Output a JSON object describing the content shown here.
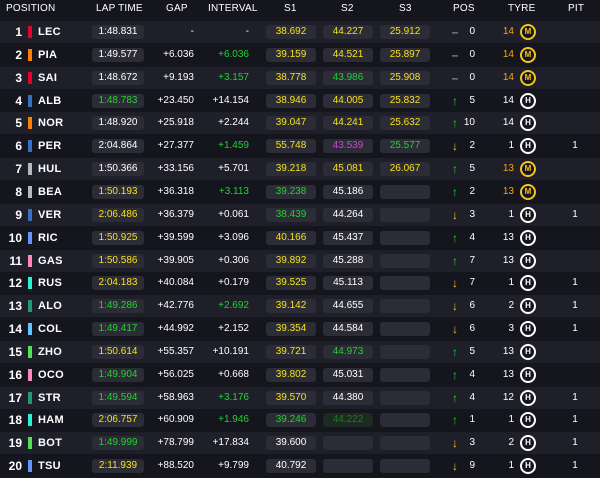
{
  "colors": {
    "yellow": "#f5e01c",
    "green": "#22d130",
    "purple": "#c94ad6",
    "white": "#ffffff",
    "orange": "#f5a511",
    "arrow_up": "#22d130",
    "arrow_down": "#f5c518"
  },
  "headers": {
    "position": "POSITION",
    "lap_time": "LAP TIME",
    "gap": "GAP",
    "interval": "INTERVAL",
    "s1": "S1",
    "s2": "S2",
    "s3": "S3",
    "pos": "POS",
    "tyre": "TYRE",
    "pit": "PIT"
  },
  "rows": [
    {
      "pos": "1",
      "code": "LEC",
      "team": "#e8002d",
      "lap": "1:48.831",
      "lap_c": "white",
      "gap": "-",
      "gap_c": "white",
      "int": "-",
      "int_c": "white",
      "s1": "38.692",
      "s1_c": "yellow",
      "s2": "44.227",
      "s2_c": "yellow",
      "s3": "25.912",
      "s3_c": "yellow",
      "dir": "none",
      "chg": "0",
      "laps": "14",
      "laps_c": "orange",
      "tyre": "M",
      "tyre_c": "#f5c518",
      "pit": ""
    },
    {
      "pos": "2",
      "code": "PIA",
      "team": "#ff8000",
      "lap": "1:49.577",
      "lap_c": "white",
      "gap": "+6.036",
      "gap_c": "white",
      "int": "+6.036",
      "int_c": "green",
      "s1": "39.159",
      "s1_c": "yellow",
      "s2": "44.521",
      "s2_c": "yellow",
      "s3": "25.897",
      "s3_c": "yellow",
      "dir": "none",
      "chg": "0",
      "laps": "14",
      "laps_c": "orange",
      "tyre": "M",
      "tyre_c": "#f5c518",
      "pit": ""
    },
    {
      "pos": "3",
      "code": "SAI",
      "team": "#e8002d",
      "lap": "1:48.672",
      "lap_c": "white",
      "gap": "+9.193",
      "gap_c": "white",
      "int": "+3.157",
      "int_c": "green",
      "s1": "38.778",
      "s1_c": "yellow",
      "s2": "43.986",
      "s2_c": "green",
      "s3": "25.908",
      "s3_c": "yellow",
      "dir": "none",
      "chg": "0",
      "laps": "14",
      "laps_c": "orange",
      "tyre": "M",
      "tyre_c": "#f5c518",
      "pit": ""
    },
    {
      "pos": "4",
      "code": "ALB",
      "team": "#3671c6",
      "lap": "1:48.783",
      "lap_c": "green",
      "gap": "+23.450",
      "gap_c": "white",
      "int": "+14.154",
      "int_c": "white",
      "s1": "38.946",
      "s1_c": "yellow",
      "s2": "44.005",
      "s2_c": "yellow",
      "s3": "25.832",
      "s3_c": "yellow",
      "dir": "up",
      "chg": "5",
      "laps": "14",
      "laps_c": "white",
      "tyre": "H",
      "tyre_c": "#ffffff",
      "pit": ""
    },
    {
      "pos": "5",
      "code": "NOR",
      "team": "#ff8000",
      "lap": "1:48.920",
      "lap_c": "white",
      "gap": "+25.918",
      "gap_c": "white",
      "int": "+2.244",
      "int_c": "white",
      "s1": "39.047",
      "s1_c": "yellow",
      "s2": "44.241",
      "s2_c": "yellow",
      "s3": "25.632",
      "s3_c": "yellow",
      "dir": "up",
      "chg": "10",
      "laps": "14",
      "laps_c": "white",
      "tyre": "H",
      "tyre_c": "#ffffff",
      "pit": ""
    },
    {
      "pos": "6",
      "code": "PER",
      "team": "#3671c6",
      "lap": "2:04.864",
      "lap_c": "white",
      "gap": "+27.377",
      "gap_c": "white",
      "int": "+1.459",
      "int_c": "green",
      "s1": "55.748",
      "s1_c": "yellow",
      "s2": "43.539",
      "s2_c": "purple",
      "s3": "25.577",
      "s3_c": "green",
      "dir": "down",
      "chg": "2",
      "laps": "1",
      "laps_c": "white",
      "tyre": "H",
      "tyre_c": "#ffffff",
      "pit": "1"
    },
    {
      "pos": "7",
      "code": "HUL",
      "team": "#b6babd",
      "lap": "1:50.366",
      "lap_c": "white",
      "gap": "+33.156",
      "gap_c": "white",
      "int": "+5.701",
      "int_c": "white",
      "s1": "39.218",
      "s1_c": "yellow",
      "s2": "45.081",
      "s2_c": "yellow",
      "s3": "26.067",
      "s3_c": "yellow",
      "dir": "up",
      "chg": "5",
      "laps": "13",
      "laps_c": "orange",
      "tyre": "M",
      "tyre_c": "#f5c518",
      "pit": ""
    },
    {
      "pos": "8",
      "code": "BEA",
      "team": "#b6babd",
      "lap": "1:50.193",
      "lap_c": "yellow",
      "gap": "+36.318",
      "gap_c": "white",
      "int": "+3.113",
      "int_c": "green",
      "s1": "39.238",
      "s1_c": "green",
      "s2": "45.186",
      "s2_c": "white",
      "s3": "",
      "s3_c": "white",
      "dir": "up",
      "chg": "2",
      "laps": "13",
      "laps_c": "orange",
      "tyre": "M",
      "tyre_c": "#f5c518",
      "pit": ""
    },
    {
      "pos": "9",
      "code": "VER",
      "team": "#3671c6",
      "lap": "2:06.486",
      "lap_c": "yellow",
      "gap": "+36.379",
      "gap_c": "white",
      "int": "+0.061",
      "int_c": "white",
      "s1": "38.439",
      "s1_c": "green",
      "s2": "44.264",
      "s2_c": "white",
      "s3": "",
      "s3_c": "white",
      "dir": "down",
      "chg": "3",
      "laps": "1",
      "laps_c": "white",
      "tyre": "H",
      "tyre_c": "#ffffff",
      "pit": "1"
    },
    {
      "pos": "10",
      "code": "RIC",
      "team": "#6692ff",
      "lap": "1:50.925",
      "lap_c": "yellow",
      "gap": "+39.599",
      "gap_c": "white",
      "int": "+3.096",
      "int_c": "white",
      "s1": "40.166",
      "s1_c": "yellow",
      "s2": "45.437",
      "s2_c": "white",
      "s3": "",
      "s3_c": "white",
      "dir": "up",
      "chg": "4",
      "laps": "13",
      "laps_c": "white",
      "tyre": "H",
      "tyre_c": "#ffffff",
      "pit": ""
    },
    {
      "pos": "11",
      "code": "GAS",
      "team": "#ff87bc",
      "lap": "1:50.586",
      "lap_c": "yellow",
      "gap": "+39.905",
      "gap_c": "white",
      "int": "+0.306",
      "int_c": "white",
      "s1": "39.892",
      "s1_c": "yellow",
      "s2": "45.288",
      "s2_c": "white",
      "s3": "",
      "s3_c": "white",
      "dir": "up",
      "chg": "7",
      "laps": "13",
      "laps_c": "white",
      "tyre": "H",
      "tyre_c": "#ffffff",
      "pit": ""
    },
    {
      "pos": "12",
      "code": "RUS",
      "team": "#27f4d2",
      "lap": "2:04.183",
      "lap_c": "yellow",
      "gap": "+40.084",
      "gap_c": "white",
      "int": "+0.179",
      "int_c": "white",
      "s1": "39.525",
      "s1_c": "yellow",
      "s2": "45.113",
      "s2_c": "white",
      "s3": "",
      "s3_c": "white",
      "dir": "down",
      "chg": "7",
      "laps": "1",
      "laps_c": "white",
      "tyre": "H",
      "tyre_c": "#ffffff",
      "pit": "1"
    },
    {
      "pos": "13",
      "code": "ALO",
      "team": "#229971",
      "lap": "1:49.286",
      "lap_c": "green",
      "gap": "+42.776",
      "gap_c": "white",
      "int": "+2.692",
      "int_c": "green",
      "s1": "39.142",
      "s1_c": "yellow",
      "s2": "44.655",
      "s2_c": "white",
      "s3": "",
      "s3_c": "white",
      "dir": "down",
      "chg": "6",
      "laps": "2",
      "laps_c": "white",
      "tyre": "H",
      "tyre_c": "#ffffff",
      "pit": "1"
    },
    {
      "pos": "14",
      "code": "COL",
      "team": "#64c4ff",
      "lap": "1:49.417",
      "lap_c": "green",
      "gap": "+44.992",
      "gap_c": "white",
      "int": "+2.152",
      "int_c": "white",
      "s1": "39.354",
      "s1_c": "yellow",
      "s2": "44.584",
      "s2_c": "white",
      "s3": "",
      "s3_c": "white",
      "dir": "down",
      "chg": "6",
      "laps": "3",
      "laps_c": "white",
      "tyre": "H",
      "tyre_c": "#ffffff",
      "pit": "1"
    },
    {
      "pos": "15",
      "code": "ZHO",
      "team": "#52e252",
      "lap": "1:50.614",
      "lap_c": "yellow",
      "gap": "+55.357",
      "gap_c": "white",
      "int": "+10.191",
      "int_c": "white",
      "s1": "39.721",
      "s1_c": "yellow",
      "s2": "44.973",
      "s2_c": "green",
      "s3": "",
      "s3_c": "white",
      "dir": "up",
      "chg": "5",
      "laps": "13",
      "laps_c": "white",
      "tyre": "H",
      "tyre_c": "#ffffff",
      "pit": ""
    },
    {
      "pos": "16",
      "code": "OCO",
      "team": "#ff87bc",
      "lap": "1:49.904",
      "lap_c": "green",
      "gap": "+56.025",
      "gap_c": "white",
      "int": "+0.668",
      "int_c": "white",
      "s1": "39.802",
      "s1_c": "yellow",
      "s2": "45.031",
      "s2_c": "white",
      "s3": "",
      "s3_c": "white",
      "dir": "up",
      "chg": "4",
      "laps": "13",
      "laps_c": "white",
      "tyre": "H",
      "tyre_c": "#ffffff",
      "pit": ""
    },
    {
      "pos": "17",
      "code": "STR",
      "team": "#229971",
      "lap": "1:49.594",
      "lap_c": "green",
      "gap": "+58.963",
      "gap_c": "white",
      "int": "+3.176",
      "int_c": "green",
      "s1": "39.570",
      "s1_c": "yellow",
      "s2": "44.380",
      "s2_c": "white",
      "s3": "",
      "s3_c": "white",
      "dir": "up",
      "chg": "4",
      "laps": "12",
      "laps_c": "white",
      "tyre": "H",
      "tyre_c": "#ffffff",
      "pit": "1"
    },
    {
      "pos": "18",
      "code": "HAM",
      "team": "#27f4d2",
      "lap": "2:06.757",
      "lap_c": "yellow",
      "gap": "+60.909",
      "gap_c": "white",
      "int": "+1.946",
      "int_c": "green",
      "s1": "39.246",
      "s1_c": "green",
      "s2": "44.222",
      "s2_c": "dimgreen",
      "s3": "",
      "s3_c": "white",
      "dir": "up",
      "chg": "1",
      "laps": "1",
      "laps_c": "white",
      "tyre": "H",
      "tyre_c": "#ffffff",
      "pit": "1"
    },
    {
      "pos": "19",
      "code": "BOT",
      "team": "#52e252",
      "lap": "1:49.999",
      "lap_c": "green",
      "gap": "+78.799",
      "gap_c": "white",
      "int": "+17.834",
      "int_c": "white",
      "s1": "39.600",
      "s1_c": "white",
      "s2": "",
      "s2_c": "white",
      "s3": "",
      "s3_c": "white",
      "dir": "down",
      "chg": "3",
      "laps": "2",
      "laps_c": "white",
      "tyre": "H",
      "tyre_c": "#ffffff",
      "pit": "1"
    },
    {
      "pos": "20",
      "code": "TSU",
      "team": "#6692ff",
      "lap": "2:11.939",
      "lap_c": "yellow",
      "gap": "+88.520",
      "gap_c": "white",
      "int": "+9.799",
      "int_c": "white",
      "s1": "40.792",
      "s1_c": "white",
      "s2": "",
      "s2_c": "white",
      "s3": "",
      "s3_c": "white",
      "dir": "down",
      "chg": "9",
      "laps": "1",
      "laps_c": "white",
      "tyre": "H",
      "tyre_c": "#ffffff",
      "pit": "1"
    }
  ]
}
